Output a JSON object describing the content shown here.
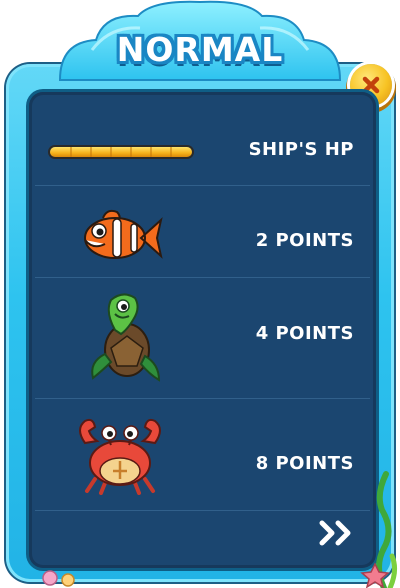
{
  "header": {
    "title": "NORMAL"
  },
  "buttons": {
    "close_icon": "close-icon",
    "next_icon": "double-chevron-right-icon"
  },
  "rows": [
    {
      "kind": "hp-bar",
      "label": "SHIP'S HP",
      "hp_fraction": 1.0
    },
    {
      "kind": "clownfish",
      "label": "2 POINTS"
    },
    {
      "kind": "turtle",
      "label": "4 POINTS"
    },
    {
      "kind": "crab",
      "label": "8 POINTS"
    }
  ],
  "colors": {
    "frame": "#2ec3ef",
    "panel": "#1b4670",
    "title_outline": "#1a86c4",
    "close_button": "#f7c324",
    "hp_bar": "#f6b21b"
  }
}
